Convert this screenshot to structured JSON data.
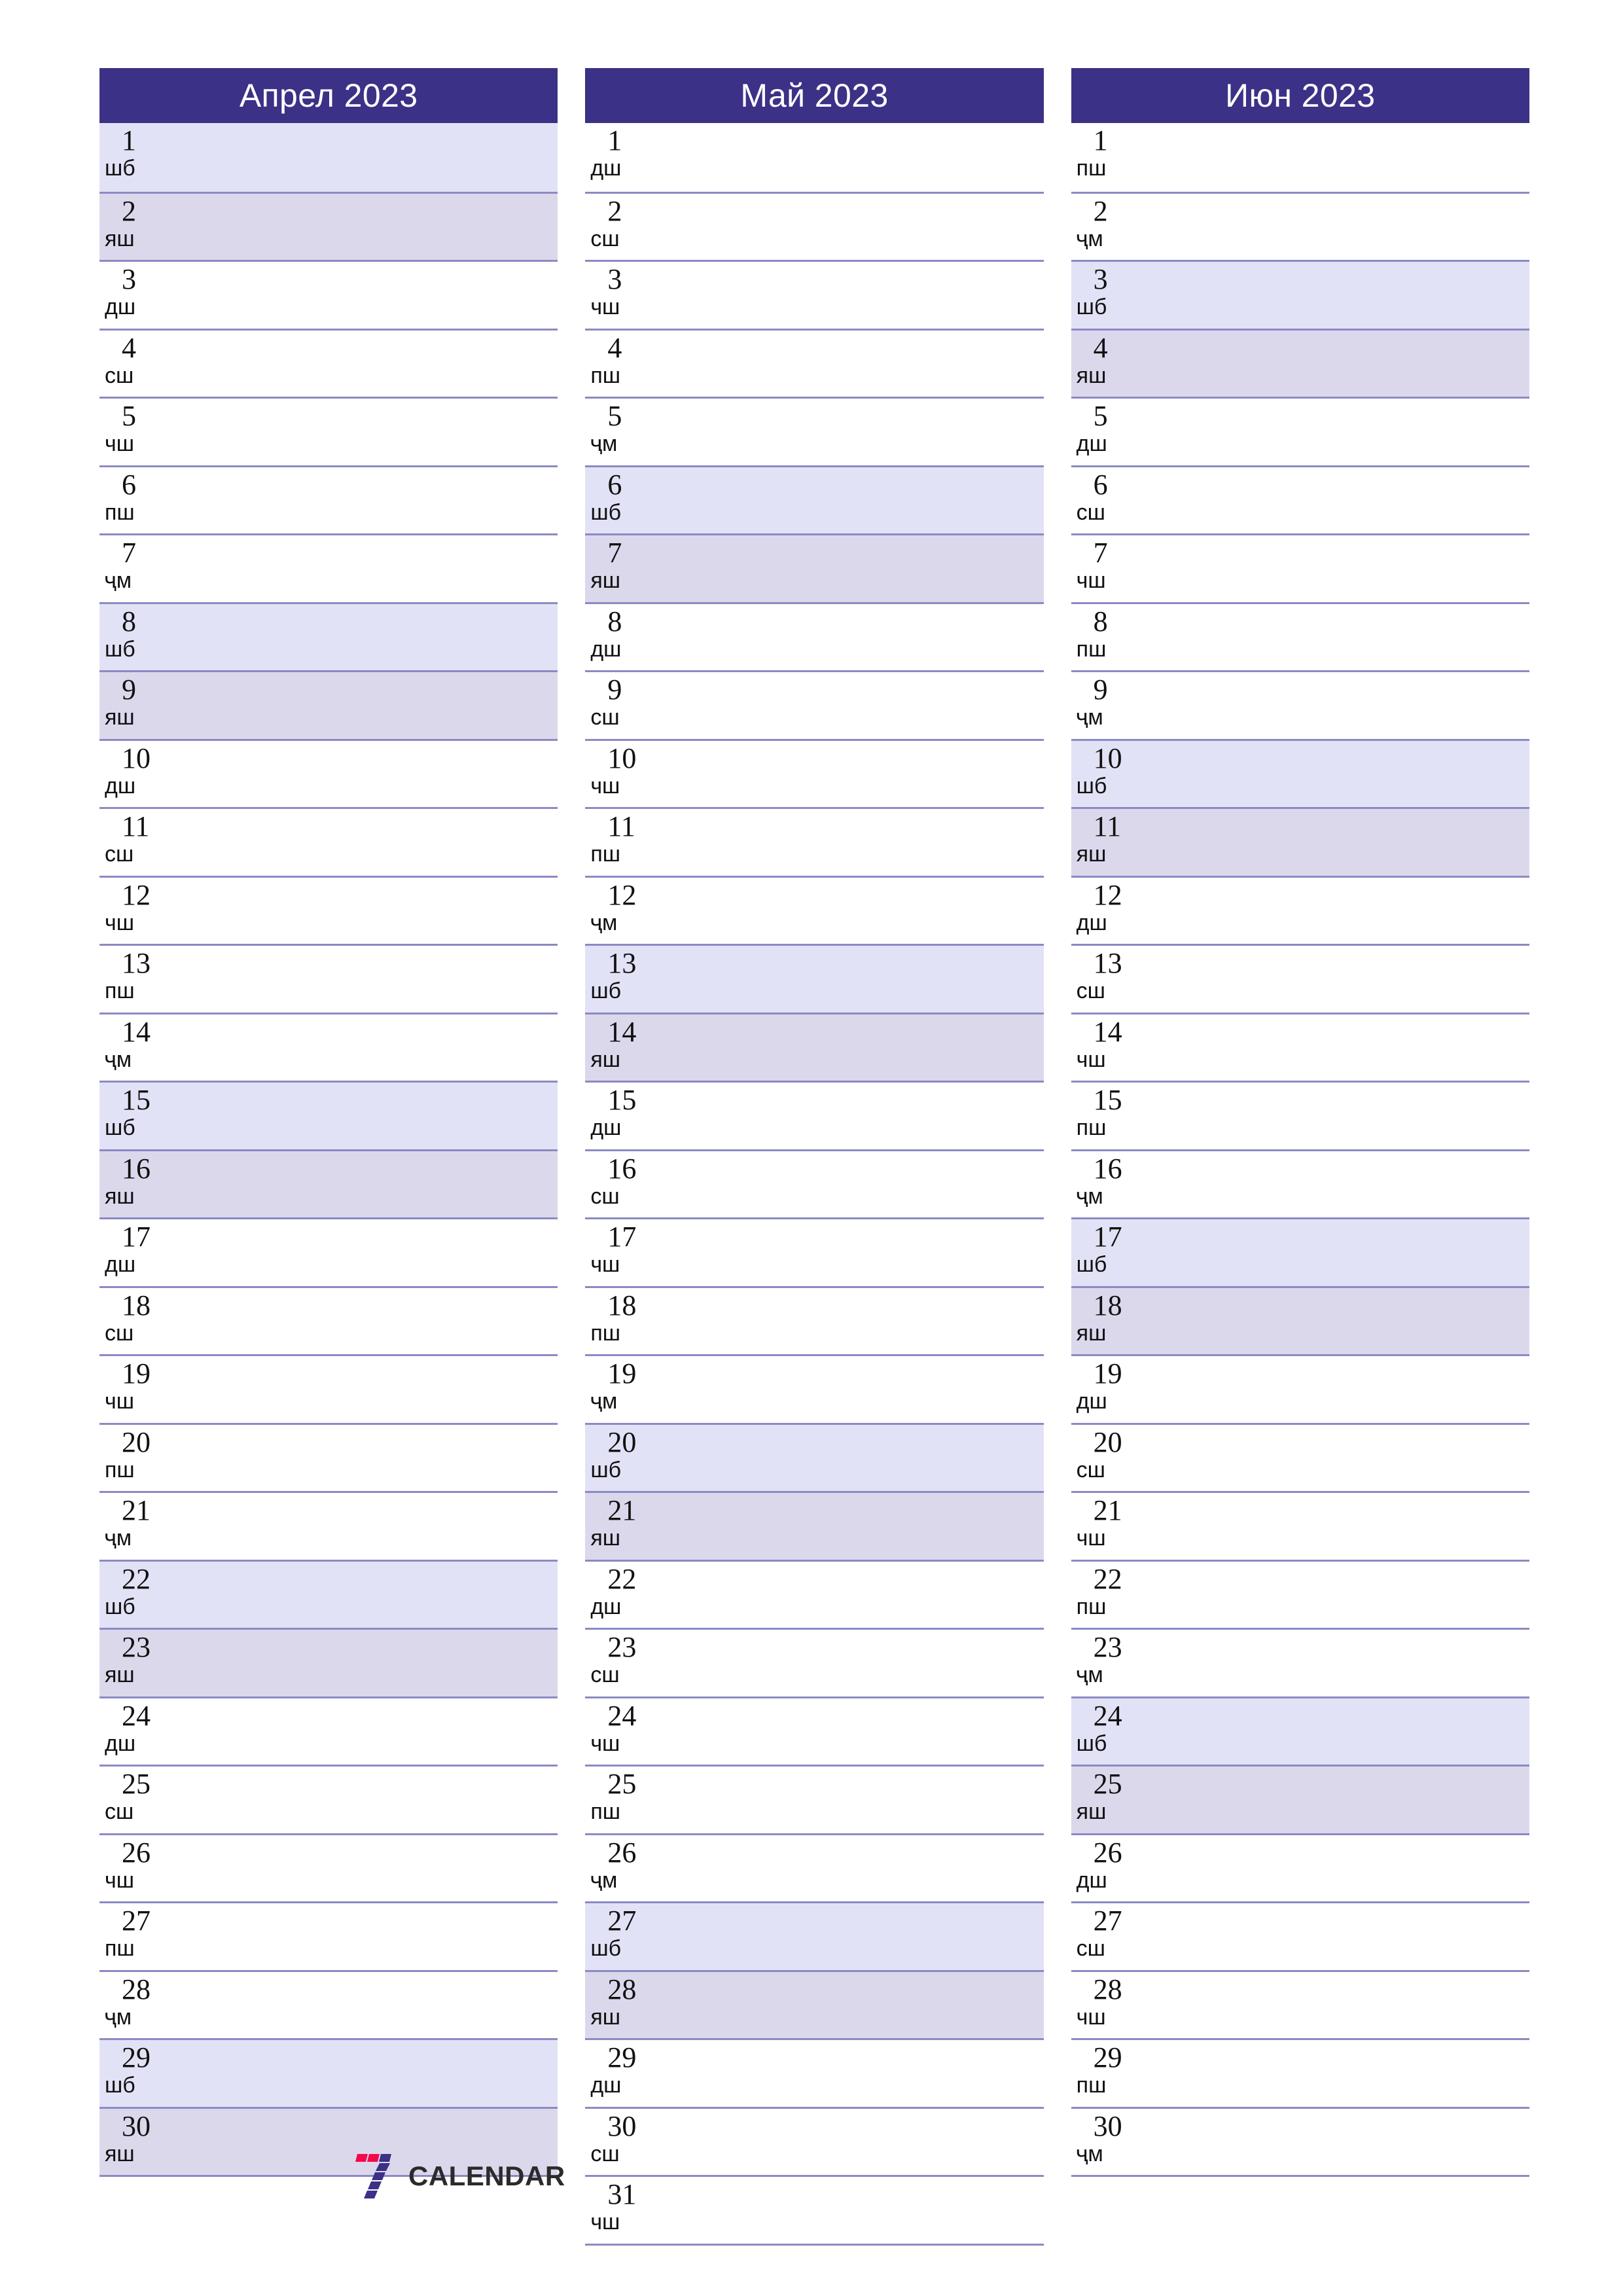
{
  "theme": {
    "header_bg": "#3b3186",
    "header_text": "#ffffff",
    "saturday_bg": "#e2e2f6",
    "sunday_bg": "#dcd8ec",
    "row_border": "#8b8ac4",
    "day_text": "#111111",
    "page_bg": "#ffffff",
    "logo_red": "#f5094a",
    "logo_purple": "#3b3186",
    "logo_word_color": "#2b2b2b"
  },
  "footer": {
    "logo_icon": "seven-calendar-logo",
    "brand": "CALENDAR"
  },
  "weekday_labels": {
    "mon": "дш",
    "tue": "сш",
    "wed": "чш",
    "thu": "пш",
    "fri": "ҷм",
    "sat": "шб",
    "sun": "яш"
  },
  "months": [
    {
      "title": "Апрел 2023",
      "name": "Апрел",
      "year": "2023",
      "days": [
        {
          "num": "1",
          "wd": "шб",
          "type": "sat"
        },
        {
          "num": "2",
          "wd": "яш",
          "type": "sun"
        },
        {
          "num": "3",
          "wd": "дш",
          "type": "wd"
        },
        {
          "num": "4",
          "wd": "сш",
          "type": "wd"
        },
        {
          "num": "5",
          "wd": "чш",
          "type": "wd"
        },
        {
          "num": "6",
          "wd": "пш",
          "type": "wd"
        },
        {
          "num": "7",
          "wd": "ҷм",
          "type": "wd"
        },
        {
          "num": "8",
          "wd": "шб",
          "type": "sat"
        },
        {
          "num": "9",
          "wd": "яш",
          "type": "sun"
        },
        {
          "num": "10",
          "wd": "дш",
          "type": "wd"
        },
        {
          "num": "11",
          "wd": "сш",
          "type": "wd"
        },
        {
          "num": "12",
          "wd": "чш",
          "type": "wd"
        },
        {
          "num": "13",
          "wd": "пш",
          "type": "wd"
        },
        {
          "num": "14",
          "wd": "ҷм",
          "type": "wd"
        },
        {
          "num": "15",
          "wd": "шб",
          "type": "sat"
        },
        {
          "num": "16",
          "wd": "яш",
          "type": "sun"
        },
        {
          "num": "17",
          "wd": "дш",
          "type": "wd"
        },
        {
          "num": "18",
          "wd": "сш",
          "type": "wd"
        },
        {
          "num": "19",
          "wd": "чш",
          "type": "wd"
        },
        {
          "num": "20",
          "wd": "пш",
          "type": "wd"
        },
        {
          "num": "21",
          "wd": "ҷм",
          "type": "wd"
        },
        {
          "num": "22",
          "wd": "шб",
          "type": "sat"
        },
        {
          "num": "23",
          "wd": "яш",
          "type": "sun"
        },
        {
          "num": "24",
          "wd": "дш",
          "type": "wd"
        },
        {
          "num": "25",
          "wd": "сш",
          "type": "wd"
        },
        {
          "num": "26",
          "wd": "чш",
          "type": "wd"
        },
        {
          "num": "27",
          "wd": "пш",
          "type": "wd"
        },
        {
          "num": "28",
          "wd": "ҷм",
          "type": "wd"
        },
        {
          "num": "29",
          "wd": "шб",
          "type": "sat"
        },
        {
          "num": "30",
          "wd": "яш",
          "type": "sun"
        }
      ]
    },
    {
      "title": "Май 2023",
      "name": "Май",
      "year": "2023",
      "days": [
        {
          "num": "1",
          "wd": "дш",
          "type": "wd"
        },
        {
          "num": "2",
          "wd": "сш",
          "type": "wd"
        },
        {
          "num": "3",
          "wd": "чш",
          "type": "wd"
        },
        {
          "num": "4",
          "wd": "пш",
          "type": "wd"
        },
        {
          "num": "5",
          "wd": "ҷм",
          "type": "wd"
        },
        {
          "num": "6",
          "wd": "шб",
          "type": "sat"
        },
        {
          "num": "7",
          "wd": "яш",
          "type": "sun"
        },
        {
          "num": "8",
          "wd": "дш",
          "type": "wd"
        },
        {
          "num": "9",
          "wd": "сш",
          "type": "wd"
        },
        {
          "num": "10",
          "wd": "чш",
          "type": "wd"
        },
        {
          "num": "11",
          "wd": "пш",
          "type": "wd"
        },
        {
          "num": "12",
          "wd": "ҷм",
          "type": "wd"
        },
        {
          "num": "13",
          "wd": "шб",
          "type": "sat"
        },
        {
          "num": "14",
          "wd": "яш",
          "type": "sun"
        },
        {
          "num": "15",
          "wd": "дш",
          "type": "wd"
        },
        {
          "num": "16",
          "wd": "сш",
          "type": "wd"
        },
        {
          "num": "17",
          "wd": "чш",
          "type": "wd"
        },
        {
          "num": "18",
          "wd": "пш",
          "type": "wd"
        },
        {
          "num": "19",
          "wd": "ҷм",
          "type": "wd"
        },
        {
          "num": "20",
          "wd": "шб",
          "type": "sat"
        },
        {
          "num": "21",
          "wd": "яш",
          "type": "sun"
        },
        {
          "num": "22",
          "wd": "дш",
          "type": "wd"
        },
        {
          "num": "23",
          "wd": "сш",
          "type": "wd"
        },
        {
          "num": "24",
          "wd": "чш",
          "type": "wd"
        },
        {
          "num": "25",
          "wd": "пш",
          "type": "wd"
        },
        {
          "num": "26",
          "wd": "ҷм",
          "type": "wd"
        },
        {
          "num": "27",
          "wd": "шб",
          "type": "sat"
        },
        {
          "num": "28",
          "wd": "яш",
          "type": "sun"
        },
        {
          "num": "29",
          "wd": "дш",
          "type": "wd"
        },
        {
          "num": "30",
          "wd": "сш",
          "type": "wd"
        },
        {
          "num": "31",
          "wd": "чш",
          "type": "wd"
        }
      ]
    },
    {
      "title": "Июн 2023",
      "name": "Июн",
      "year": "2023",
      "days": [
        {
          "num": "1",
          "wd": "пш",
          "type": "wd"
        },
        {
          "num": "2",
          "wd": "ҷм",
          "type": "wd"
        },
        {
          "num": "3",
          "wd": "шб",
          "type": "sat"
        },
        {
          "num": "4",
          "wd": "яш",
          "type": "sun"
        },
        {
          "num": "5",
          "wd": "дш",
          "type": "wd"
        },
        {
          "num": "6",
          "wd": "сш",
          "type": "wd"
        },
        {
          "num": "7",
          "wd": "чш",
          "type": "wd"
        },
        {
          "num": "8",
          "wd": "пш",
          "type": "wd"
        },
        {
          "num": "9",
          "wd": "ҷм",
          "type": "wd"
        },
        {
          "num": "10",
          "wd": "шб",
          "type": "sat"
        },
        {
          "num": "11",
          "wd": "яш",
          "type": "sun"
        },
        {
          "num": "12",
          "wd": "дш",
          "type": "wd"
        },
        {
          "num": "13",
          "wd": "сш",
          "type": "wd"
        },
        {
          "num": "14",
          "wd": "чш",
          "type": "wd"
        },
        {
          "num": "15",
          "wd": "пш",
          "type": "wd"
        },
        {
          "num": "16",
          "wd": "ҷм",
          "type": "wd"
        },
        {
          "num": "17",
          "wd": "шб",
          "type": "sat"
        },
        {
          "num": "18",
          "wd": "яш",
          "type": "sun"
        },
        {
          "num": "19",
          "wd": "дш",
          "type": "wd"
        },
        {
          "num": "20",
          "wd": "сш",
          "type": "wd"
        },
        {
          "num": "21",
          "wd": "чш",
          "type": "wd"
        },
        {
          "num": "22",
          "wd": "пш",
          "type": "wd"
        },
        {
          "num": "23",
          "wd": "ҷм",
          "type": "wd"
        },
        {
          "num": "24",
          "wd": "шб",
          "type": "sat"
        },
        {
          "num": "25",
          "wd": "яш",
          "type": "sun"
        },
        {
          "num": "26",
          "wd": "дш",
          "type": "wd"
        },
        {
          "num": "27",
          "wd": "сш",
          "type": "wd"
        },
        {
          "num": "28",
          "wd": "чш",
          "type": "wd"
        },
        {
          "num": "29",
          "wd": "пш",
          "type": "wd"
        },
        {
          "num": "30",
          "wd": "ҷм",
          "type": "wd"
        }
      ]
    }
  ]
}
